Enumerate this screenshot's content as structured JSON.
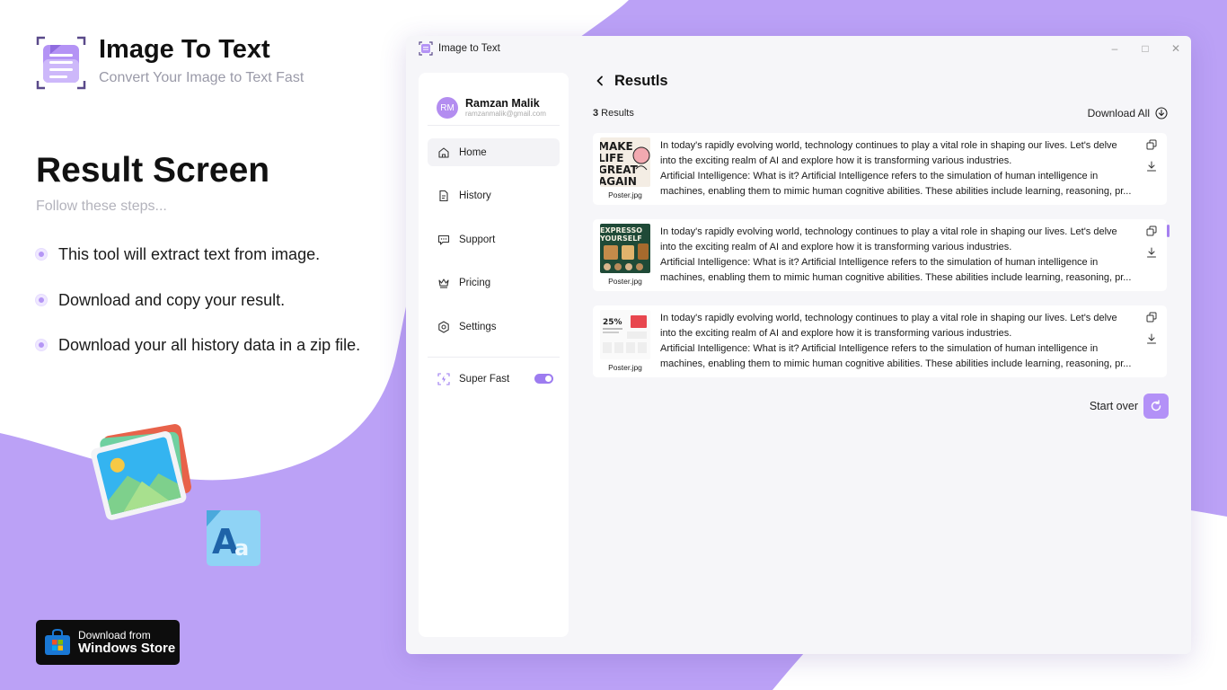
{
  "brand": {
    "title": "Image To Text",
    "subtitle": "Convert Your Image to Text Fast"
  },
  "section": {
    "title": "Result Screen",
    "subtitle": "Follow these steps...",
    "steps": [
      "This tool will extract text from image.",
      "Download and copy your result.",
      "Download your all history data in a zip file."
    ]
  },
  "store": {
    "small": "Download from",
    "big": "Windows Store"
  },
  "window": {
    "title": "Image to Text"
  },
  "profile": {
    "initials": "RM",
    "name": "Ramzan Malik",
    "email": "ramzanmalik@gmail.com"
  },
  "nav": [
    {
      "label": "Home",
      "icon": "home-icon"
    },
    {
      "label": "History",
      "icon": "document-icon"
    },
    {
      "label": "Support",
      "icon": "chat-icon"
    },
    {
      "label": "Pricing",
      "icon": "crown-icon"
    },
    {
      "label": "Settings",
      "icon": "gear-icon"
    }
  ],
  "super_fast": {
    "label": "Super Fast",
    "enabled": true
  },
  "main": {
    "title": "Resutls",
    "results_count": "3",
    "results_label": " Results",
    "download_all": "Download All",
    "start_over": "Start over"
  },
  "results": [
    {
      "file": "Poster.jpg",
      "lines": [
        "In today's rapidly evolving world, technology continues to play a vital role in shaping our lives.   Let's delve",
        "into the exciting realm of AI and explore how it is transforming various industries.",
        "Artificial Intelligence: What is it? Artificial Intelligence refers to the simulation of human intelligence in",
        "machines, enabling them to mimic human cognitive abilities. These abilities include learning, reasoning, pr..."
      ]
    },
    {
      "file": "Poster.jpg",
      "lines": [
        "In today's rapidly evolving world, technology continues to play a vital role in shaping our lives.   Let's delve",
        "into the exciting realm of AI and explore how it is transforming various industries.",
        "Artificial Intelligence: What is it? Artificial Intelligence refers to the simulation of human intelligence in",
        "machines, enabling them to mimic human cognitive abilities. These abilities include learning, reasoning, pr..."
      ]
    },
    {
      "file": "Poster.jpg",
      "lines": [
        "In today's rapidly evolving world, technology continues to play a vital role in shaping our lives.   Let's delve",
        "into the exciting realm of AI and explore how it is transforming various industries.",
        "Artificial Intelligence: What is it? Artificial Intelligence refers to the simulation of human intelligence in",
        "machines, enabling them to mimic human cognitive abilities. These abilities include learning, reasoning, pr..."
      ]
    }
  ],
  "thumb_texts": {
    "poster1": [
      "MAKE",
      "LIFE",
      "GREAT",
      "AGAIN"
    ],
    "poster2": [
      "EXPRESSO",
      "YOURSELF"
    ],
    "poster3": "25%"
  },
  "colors": {
    "accent": "#b391f7",
    "background_purple": "#bba1f6"
  }
}
